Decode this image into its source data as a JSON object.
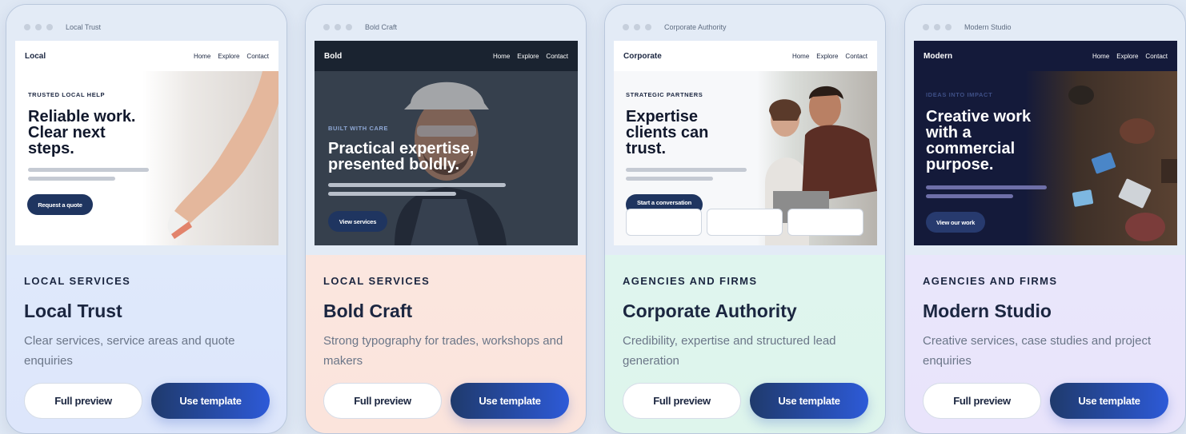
{
  "cards": [
    {
      "window_title": "Local Trust",
      "preview": {
        "brand": "Local",
        "nav": [
          "Home",
          "Explore",
          "Contact"
        ],
        "eyebrow": "TRUSTED LOCAL HELP",
        "headline": "Reliable work. Clear next steps.",
        "cta": "Request a quote"
      },
      "category": "LOCAL SERVICES",
      "title": "Local Trust",
      "description": "Clear services, service areas and quote enquiries",
      "buttons": {
        "preview": "Full preview",
        "use": "Use template"
      }
    },
    {
      "window_title": "Bold Craft",
      "preview": {
        "brand": "Bold",
        "nav": [
          "Home",
          "Explore",
          "Contact"
        ],
        "eyebrow": "BUILT WITH CARE",
        "headline": "Practical expertise, presented boldly.",
        "cta": "View services"
      },
      "category": "LOCAL SERVICES",
      "title": "Bold Craft",
      "description": "Strong typography for trades, workshops and makers",
      "buttons": {
        "preview": "Full preview",
        "use": "Use template"
      }
    },
    {
      "window_title": "Corporate Authority",
      "preview": {
        "brand": "Corporate",
        "nav": [
          "Home",
          "Explore",
          "Contact"
        ],
        "eyebrow": "STRATEGIC PARTNERS",
        "headline": "Expertise clients can trust.",
        "cta": "Start a conversation"
      },
      "category": "AGENCIES AND FIRMS",
      "title": "Corporate Authority",
      "description": "Credibility, expertise and structured lead generation",
      "buttons": {
        "preview": "Full preview",
        "use": "Use template"
      }
    },
    {
      "window_title": "Modern Studio",
      "preview": {
        "brand": "Modern",
        "nav": [
          "Home",
          "Explore",
          "Contact"
        ],
        "eyebrow": "IDEAS INTO IMPACT",
        "headline": "Creative work with a commercial purpose.",
        "cta": "View our work"
      },
      "category": "AGENCIES AND FIRMS",
      "title": "Modern Studio",
      "description": "Creative services, case studies and project enquiries",
      "buttons": {
        "preview": "Full preview",
        "use": "Use template"
      }
    }
  ],
  "colors": {
    "navy": "#1b2640",
    "primary_start": "#1f3a6c",
    "primary_end": "#2d5ad8",
    "muted_text": "#6b7688"
  }
}
